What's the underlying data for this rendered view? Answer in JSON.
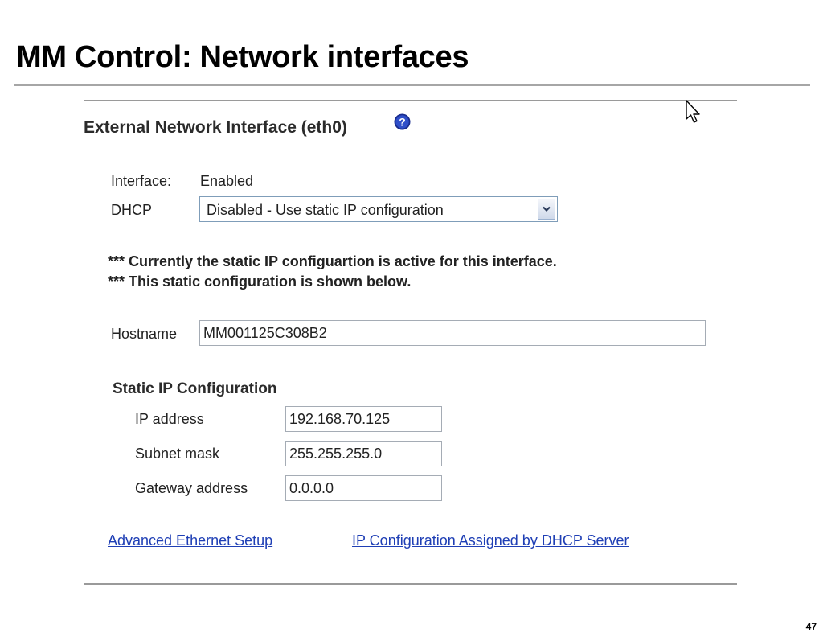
{
  "slide": {
    "title": "MM Control: Network interfaces",
    "page_number": "47"
  },
  "panel": {
    "heading": "External Network Interface (eth0)",
    "help_icon": "help-question-icon",
    "interface_label": "Interface:",
    "interface_value": "Enabled",
    "dhcp_label": "DHCP",
    "dhcp_selected": "Disabled - Use static IP configuration",
    "note_line1": "*** Currently the static IP configuartion is active for this interface.",
    "note_line2": "*** This static configuration is shown below.",
    "hostname_label": "Hostname",
    "hostname_value": "MM001125C308B2",
    "static_heading": "Static IP Configuration",
    "ip_label": "IP address",
    "ip_value": "192.168.70.125",
    "subnet_label": "Subnet mask",
    "subnet_value": "255.255.255.0",
    "gateway_label": "Gateway address",
    "gateway_value": "0.0.0.0",
    "link_advanced": "Advanced Ethernet Setup",
    "link_dhcp": "IP Configuration Assigned by DHCP Server"
  },
  "colors": {
    "link": "#1f3fb5",
    "help_icon": "#1a2d8f"
  }
}
